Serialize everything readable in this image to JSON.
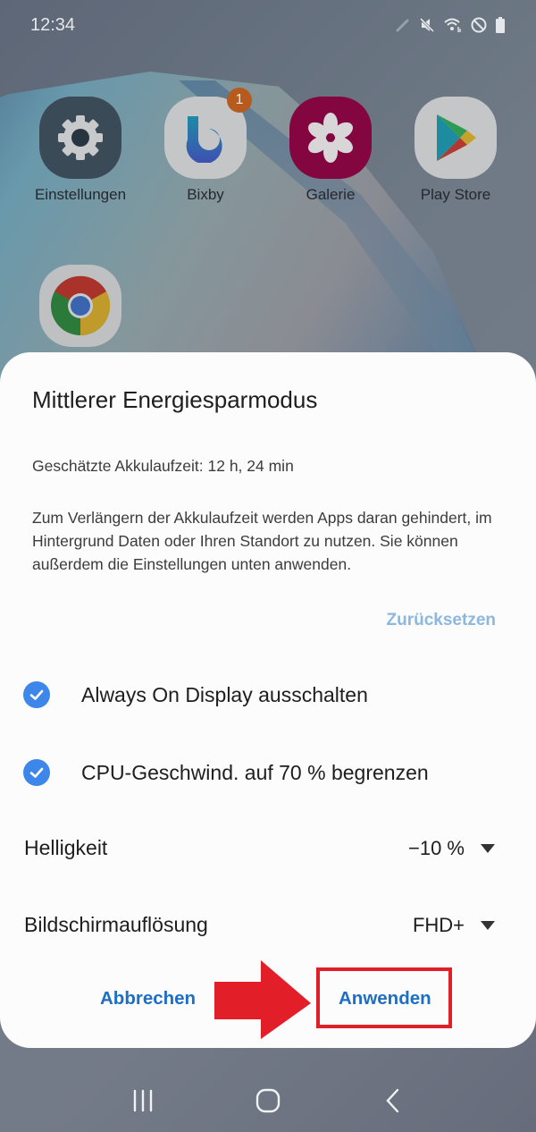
{
  "status_bar": {
    "time": "12:34",
    "icons": [
      "edit-pencil-icon",
      "mute-icon",
      "wifi-icon",
      "do-not-disturb-icon",
      "battery-icon"
    ]
  },
  "home_screen": {
    "apps": [
      {
        "label": "Einstellungen",
        "icon": "settings-gear-icon"
      },
      {
        "label": "Bixby",
        "icon": "bixby-icon",
        "badge": "1"
      },
      {
        "label": "Galerie",
        "icon": "gallery-flower-icon"
      },
      {
        "label": "Play Store",
        "icon": "play-store-icon"
      },
      {
        "label": "",
        "icon": "chrome-icon"
      }
    ]
  },
  "dialog": {
    "title": "Mittlerer Energiesparmodus",
    "estimate": "Geschätzte Akkulaufzeit: 12 h, 24 min",
    "description": "Zum Verlängern der Akkulaufzeit werden Apps daran gehindert, im Hintergrund Daten oder Ihren Standort zu nutzen. Sie können außerdem die Einstellungen unten anwenden.",
    "reset_label": "Zurücksetzen",
    "options": [
      {
        "label": "Always On Display ausschalten",
        "checked": true
      },
      {
        "label": "CPU-Geschwind. auf 70 % begrenzen",
        "checked": true
      }
    ],
    "selects": [
      {
        "label": "Helligkeit",
        "value": "−10 %"
      },
      {
        "label": "Bildschirmauflösung",
        "value": "FHD+"
      }
    ],
    "cancel_label": "Abbrechen",
    "apply_label": "Anwenden"
  },
  "annotation": {
    "arrow_color": "#e21f28",
    "highlight_target": "Anwenden"
  },
  "colors": {
    "accent": "#3d86ea",
    "button_text": "#1d6ec5",
    "reset_text": "#8cb8e0"
  },
  "nav_bar": {
    "buttons": [
      "recent-apps",
      "home",
      "back"
    ]
  }
}
